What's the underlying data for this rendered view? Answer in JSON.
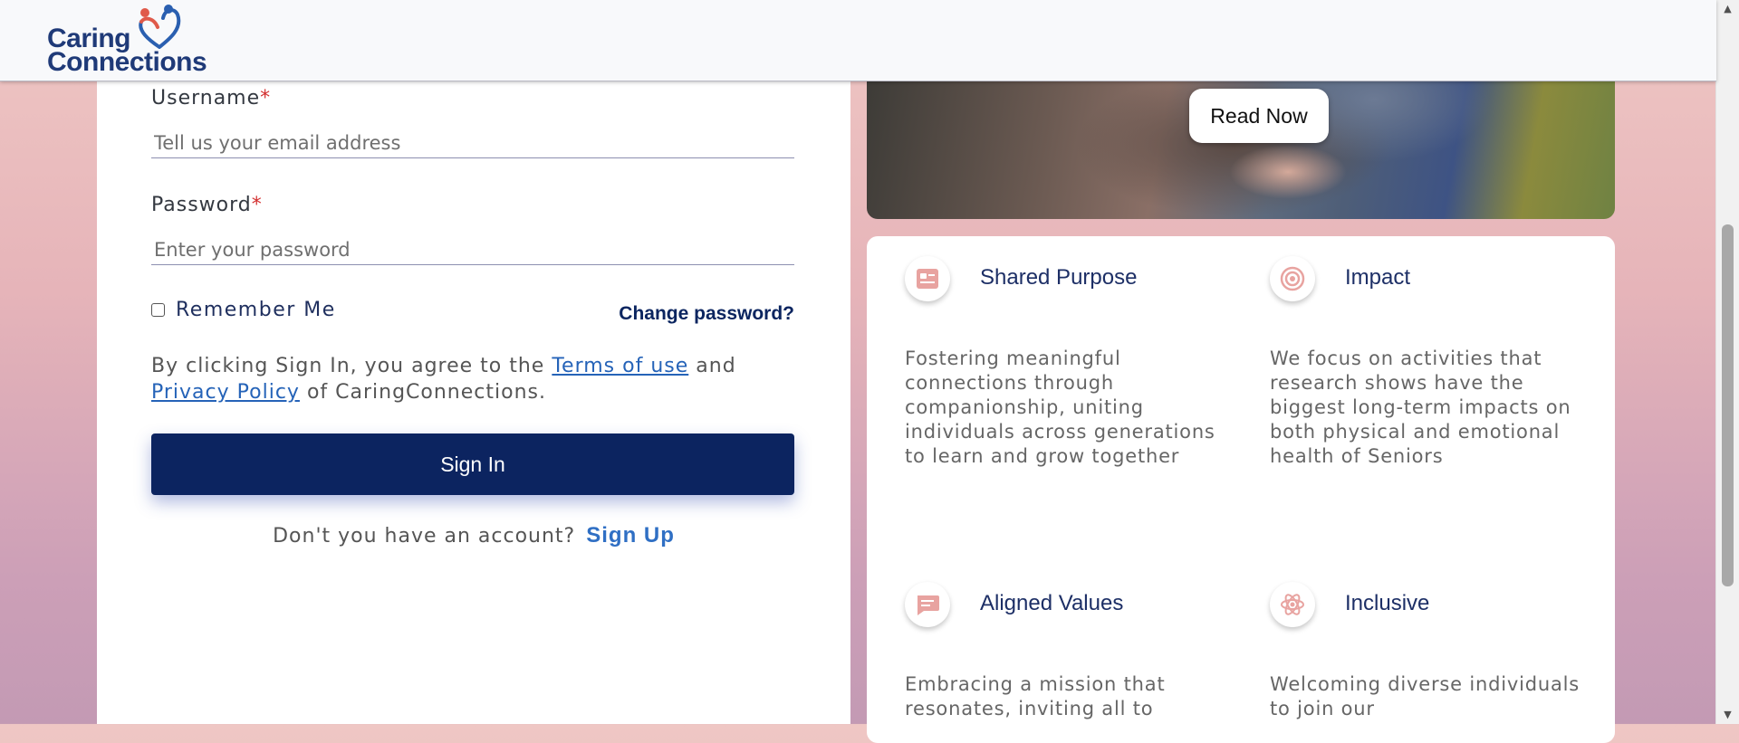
{
  "header": {
    "logo_line1": "Caring",
    "logo_line2": "Connections"
  },
  "form": {
    "username_label": "Username",
    "username_placeholder": "Tell us your email address",
    "password_label": "Password",
    "password_placeholder": "Enter your password",
    "required_mark": "*",
    "remember_label": "Remember Me",
    "change_password": "Change password?",
    "terms_prefix": "By clicking Sign In, you agree to the",
    "terms_link": "Terms of use",
    "terms_and": "and",
    "privacy_link": "Privacy Policy",
    "terms_suffix": "of CaringConnections.",
    "signin_label": "Sign In",
    "no_account_text": "Don't you have an account?",
    "signup_link": "Sign Up"
  },
  "banner": {
    "read_now": "Read Now"
  },
  "features": [
    {
      "icon": "badge-icon",
      "title": "Shared Purpose",
      "description": "Fostering meaningful connections through companionship, uniting individuals across generations to learn and grow together"
    },
    {
      "icon": "target-icon",
      "title": "Impact",
      "description": "We focus on activities that research shows have the biggest long-term impacts on both physical and emotional health of Seniors"
    },
    {
      "icon": "chat-icon",
      "title": "Aligned Values",
      "description": "Embracing a mission that resonates, inviting all to"
    },
    {
      "icon": "atom-icon",
      "title": "Inclusive",
      "description": "Welcoming diverse individuals to join our"
    }
  ],
  "colors": {
    "brand_navy": "#0c2460",
    "link_blue": "#2563b8",
    "required_red": "#d32f2f",
    "icon_pink": "#e8a3a0"
  }
}
